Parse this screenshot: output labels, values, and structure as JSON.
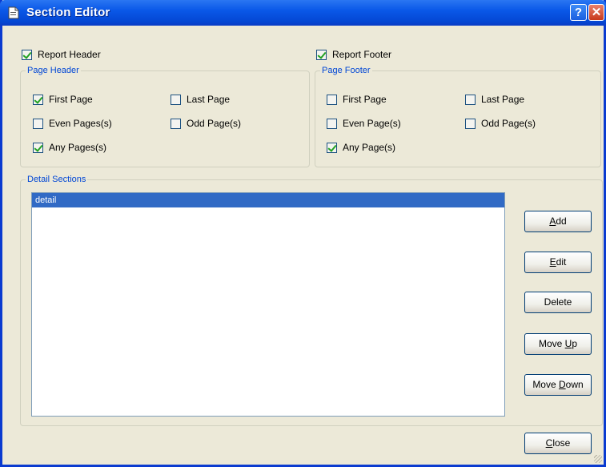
{
  "window": {
    "title": "Section Editor",
    "help_glyph": "?",
    "close_glyph": "✕"
  },
  "report_header": {
    "label": "Report Header",
    "checked": true
  },
  "report_footer": {
    "label": "Report Footer",
    "checked": true
  },
  "page_header": {
    "legend": "Page Header",
    "options": [
      {
        "label": "First Page",
        "checked": true
      },
      {
        "label": "Last Page",
        "checked": false
      },
      {
        "label": "Even Pages(s)",
        "checked": false
      },
      {
        "label": "Odd Page(s)",
        "checked": false
      },
      {
        "label": "Any Pages(s)",
        "checked": true
      }
    ]
  },
  "page_footer": {
    "legend": "Page Footer",
    "options": [
      {
        "label": "First Page",
        "checked": false
      },
      {
        "label": "Last Page",
        "checked": false
      },
      {
        "label": "Even Page(s)",
        "checked": false
      },
      {
        "label": "Odd Page(s)",
        "checked": false
      },
      {
        "label": "Any Page(s)",
        "checked": true
      }
    ]
  },
  "detail_sections": {
    "legend": "Detail Sections",
    "items": [
      {
        "label": "detail",
        "selected": true
      }
    ]
  },
  "buttons": {
    "add": {
      "pre": "",
      "u": "A",
      "post": "dd"
    },
    "edit": {
      "pre": "",
      "u": "E",
      "post": "dit"
    },
    "delete": {
      "pre": "Delete",
      "u": "",
      "post": ""
    },
    "move_up": {
      "pre": "Move ",
      "u": "U",
      "post": "p"
    },
    "move_down": {
      "pre": "Move ",
      "u": "D",
      "post": "own"
    },
    "close": {
      "pre": "",
      "u": "C",
      "post": "lose"
    }
  },
  "colors": {
    "title_bar": "#0a58e8",
    "selection": "#316ac5",
    "legend_text": "#0046d5",
    "checkmark": "#21a121"
  }
}
